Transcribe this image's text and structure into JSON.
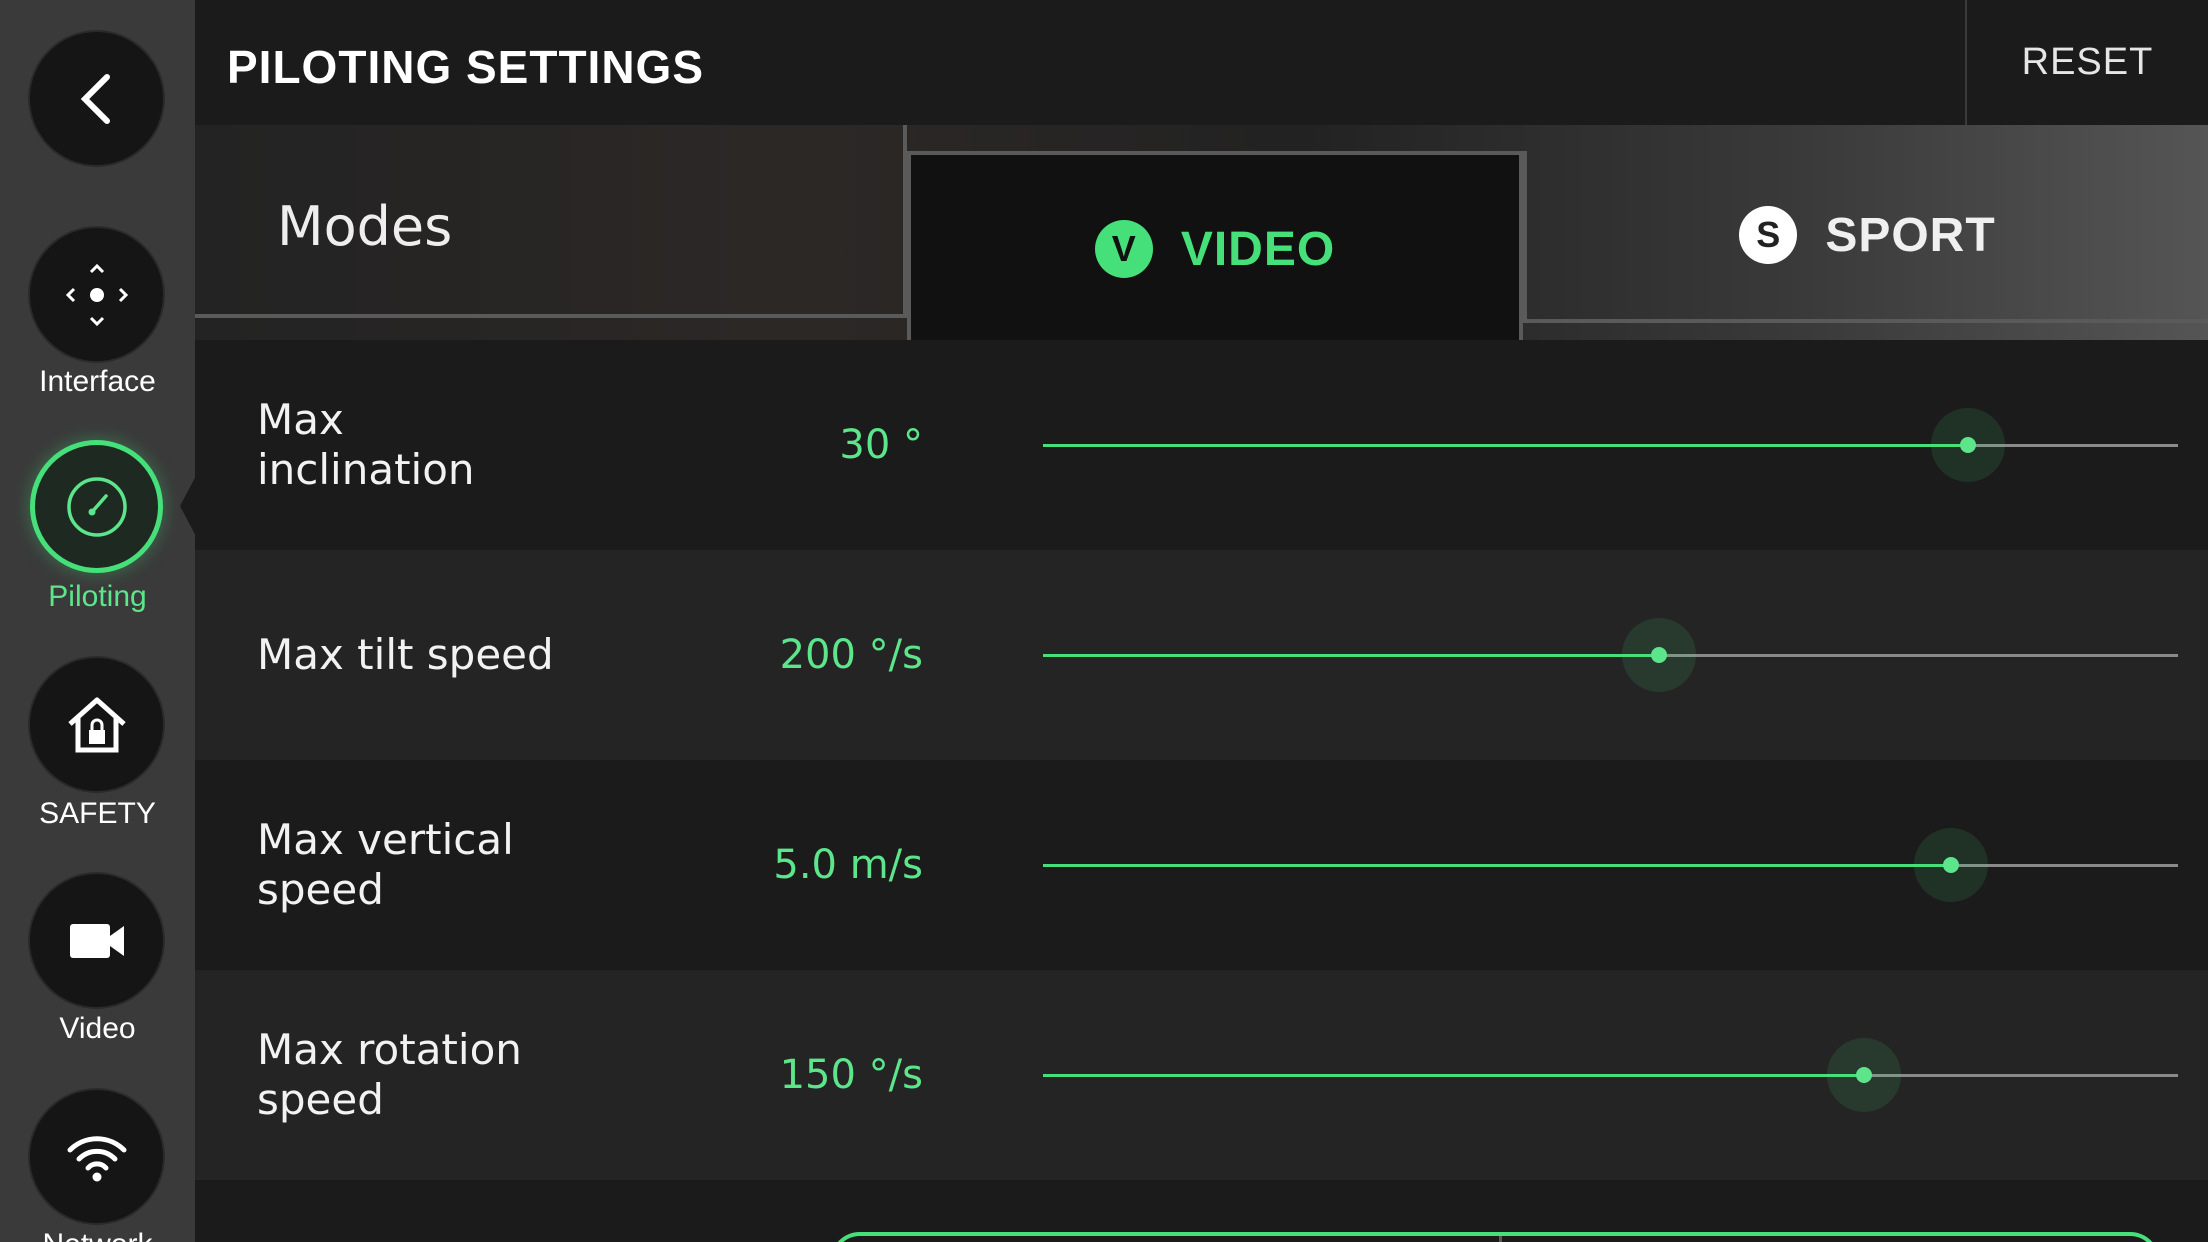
{
  "header": {
    "title": "PILOTING SETTINGS",
    "reset_label": "RESET"
  },
  "sidebar": {
    "items": [
      {
        "label": "",
        "icon": "back-arrow-icon"
      },
      {
        "label": "Interface",
        "icon": "interface-icon"
      },
      {
        "label": "Piloting",
        "icon": "piloting-gauge-icon",
        "active": true
      },
      {
        "label": "SAFETY",
        "icon": "home-lock-icon"
      },
      {
        "label": "Video",
        "icon": "video-camera-icon"
      },
      {
        "label": "Network",
        "icon": "wifi-icon"
      }
    ]
  },
  "modes": {
    "label": "Modes",
    "tabs": [
      {
        "badge": "V",
        "name": "VIDEO",
        "selected": true
      },
      {
        "badge": "S",
        "name": "SPORT",
        "selected": false
      }
    ]
  },
  "settings": [
    {
      "label": "Max\ninclination",
      "value": "30 °",
      "fraction": 0.815
    },
    {
      "label": "Max tilt speed",
      "value": "200 °/s",
      "fraction": 0.543
    },
    {
      "label": "Max vertical\nspeed",
      "value": "5.0 m/s",
      "fraction": 0.8
    },
    {
      "label": "Max rotation\nspeed",
      "value": "150 °/s",
      "fraction": 0.723
    }
  ],
  "colors": {
    "accent": "#46e07a",
    "background": "#1b1b1b",
    "sidebar": "#3a3a3a"
  }
}
